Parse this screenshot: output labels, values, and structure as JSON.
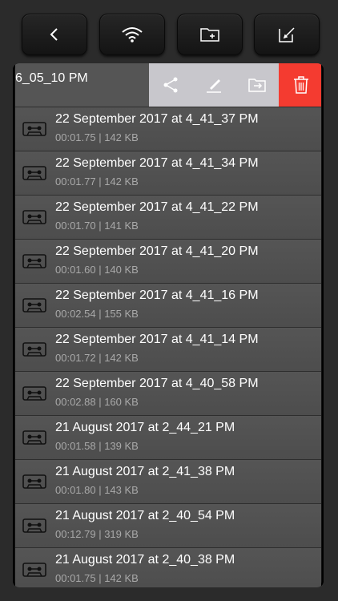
{
  "toolbar": {
    "buttons": [
      {
        "name": "back-button",
        "icon": "chevron-left-icon"
      },
      {
        "name": "wifi-button",
        "icon": "wifi-icon"
      },
      {
        "name": "new-folder-button",
        "icon": "folder-plus-icon"
      },
      {
        "name": "edit-button",
        "icon": "edit-icon"
      }
    ]
  },
  "swiped_row": {
    "title": "6_05_10 PM",
    "actions": [
      "share-icon",
      "rename-icon",
      "move-icon",
      "trash-icon"
    ]
  },
  "recordings": [
    {
      "title": "22 September 2017 at 4_41_37 PM",
      "meta": "00:01.75 | 142 KB"
    },
    {
      "title": "22 September 2017 at 4_41_34 PM",
      "meta": "00:01.77 | 142 KB"
    },
    {
      "title": "22 September 2017 at 4_41_22 PM",
      "meta": "00:01.70 | 141 KB"
    },
    {
      "title": "22 September 2017 at 4_41_20 PM",
      "meta": "00:01.60 | 140 KB"
    },
    {
      "title": "22 September 2017 at 4_41_16 PM",
      "meta": "00:02.54 | 155 KB"
    },
    {
      "title": "22 September 2017 at 4_41_14 PM",
      "meta": "00:01.72 | 142 KB"
    },
    {
      "title": "22 September 2017 at 4_40_58 PM",
      "meta": "00:02.88 | 160 KB"
    },
    {
      "title": "21 August 2017 at 2_44_21 PM",
      "meta": "00:01.58 | 139 KB"
    },
    {
      "title": "21 August 2017 at 2_41_38 PM",
      "meta": "00:01.80 | 143 KB"
    },
    {
      "title": "21 August 2017 at 2_40_54 PM",
      "meta": "00:12.79 | 319 KB"
    },
    {
      "title": "21 August 2017 at 2_40_38 PM",
      "meta": "00:01.75 | 142 KB"
    }
  ],
  "colors": {
    "delete": "#f43b30",
    "action_bg": "#c8c7cc",
    "row_bg": "#555555"
  }
}
